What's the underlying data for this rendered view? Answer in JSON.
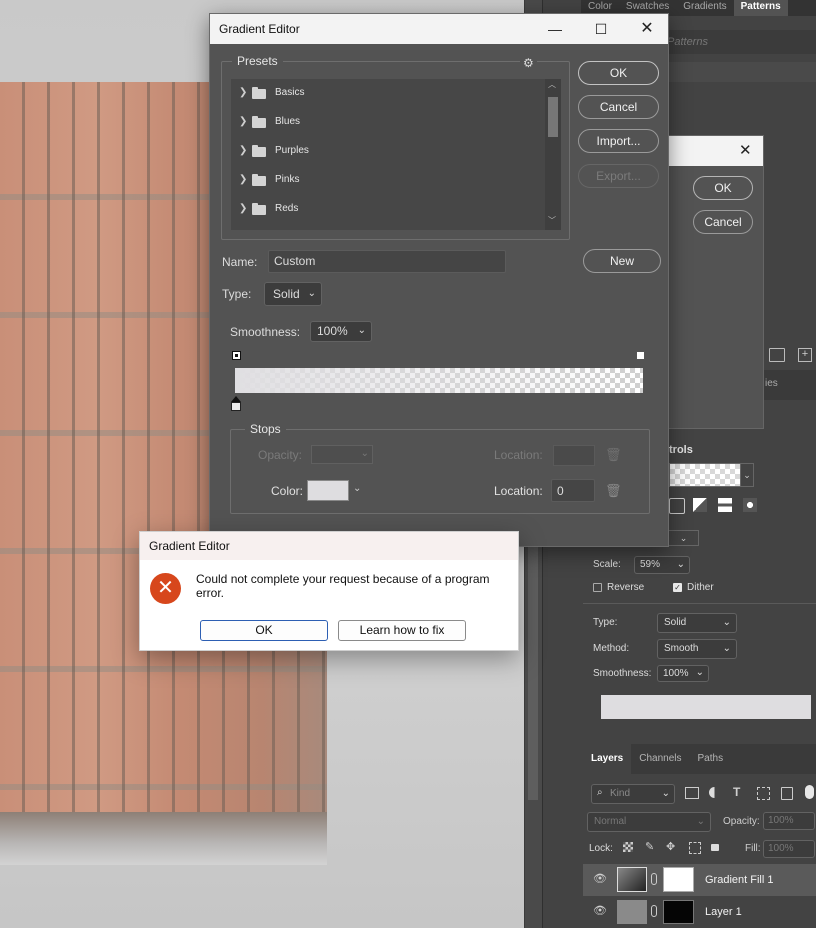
{
  "gradient_editor": {
    "title": "Gradient Editor",
    "presets_label": "Presets",
    "presets": [
      {
        "label": "Basics"
      },
      {
        "label": "Blues"
      },
      {
        "label": "Purples"
      },
      {
        "label": "Pinks"
      },
      {
        "label": "Reds"
      }
    ],
    "buttons": {
      "ok": "OK",
      "cancel": "Cancel",
      "import": "Import...",
      "export": "Export...",
      "new": "New"
    },
    "name_label": "Name:",
    "name_value": "Custom",
    "type_label": "Type:",
    "type_value": "Solid",
    "smoothness_label": "Smoothness:",
    "smoothness_value": "100%",
    "stops_label": "Stops",
    "opacity_label": "Opacity:",
    "location_label": "Location:",
    "color_label": "Color:",
    "location_value": "0",
    "colors": {
      "stop_color": "#dedde0"
    }
  },
  "error_dialog": {
    "title": "Gradient Editor",
    "message": "Could not complete your request because of a program error.",
    "ok": "OK",
    "learn": "Learn how to fix"
  },
  "behind_dialog": {
    "ok": "OK",
    "cancel": "Cancel"
  },
  "right_panel": {
    "top_tabs": [
      "Color",
      "Swatches",
      "Gradients",
      "Patterns"
    ],
    "active_top_tab": "Patterns",
    "patterns_search_placeholder": "Patterns",
    "controls_label": "trols",
    "ies_label": "ies",
    "scale_label": "Scale:",
    "scale_value": "59%",
    "reverse_label": "Reverse",
    "dither_label": "Dither",
    "type_label": "Type:",
    "type_value": "Solid",
    "method_label": "Method:",
    "method_value": "Smooth",
    "smoothness_label": "Smoothness:",
    "smoothness_value": "100%",
    "layers_tabs": [
      "Layers",
      "Channels",
      "Paths"
    ],
    "kind_placeholder": "Kind",
    "blend_mode": "Normal",
    "opacity_label": "Opacity:",
    "opacity_value": "100%",
    "lock_label": "Lock:",
    "fill_label": "Fill:",
    "fill_value": "100%",
    "layers": [
      {
        "name": "Gradient Fill 1"
      },
      {
        "name": "Layer 1"
      }
    ]
  }
}
